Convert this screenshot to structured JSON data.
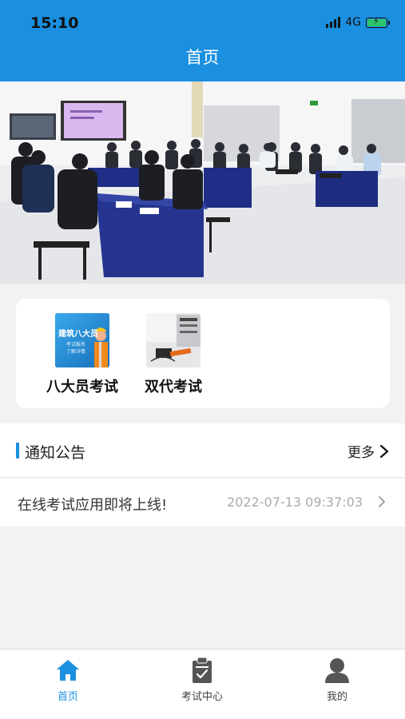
{
  "status": {
    "time": "15:10",
    "network": "4G"
  },
  "header": {
    "title": "首页"
  },
  "banner": {
    "slide_count": 2,
    "active_slide": 1
  },
  "exams": [
    {
      "label": "八大员考试",
      "thumb_line1": "建筑八大员",
      "thumb_line2": "考试报名",
      "thumb_line3": "了解详情"
    },
    {
      "label": "双代考试"
    }
  ],
  "notices": {
    "title": "通知公告",
    "more_label": "更多",
    "items": [
      {
        "text": "在线考试应用即将上线!",
        "date": "2022-07-13 09:37:03"
      }
    ]
  },
  "tabs": [
    {
      "label": "首页",
      "icon": "home-icon",
      "active": true
    },
    {
      "label": "考试中心",
      "icon": "clipboard-icon",
      "active": false
    },
    {
      "label": "我的",
      "icon": "user-icon",
      "active": false
    }
  ],
  "colors": {
    "primary": "#1b8fe0",
    "background": "#f2f2f2"
  }
}
